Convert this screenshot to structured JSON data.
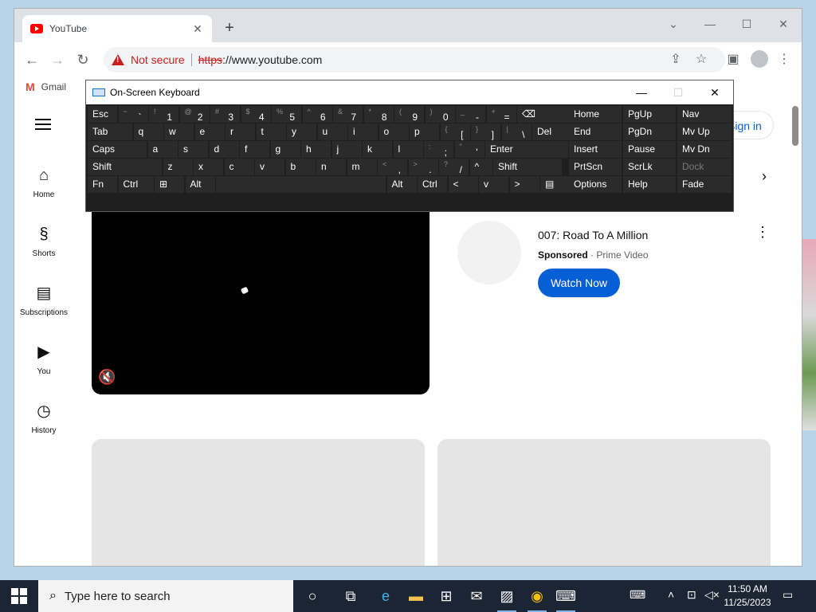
{
  "browser": {
    "tab_title": "YouTube",
    "tab_close": "✕",
    "new_tab": "+",
    "address": {
      "security_label": "Not secure",
      "scheme": "https",
      "rest": "://www.youtube.com"
    },
    "bookmarks": [
      {
        "label": "Gmail"
      }
    ]
  },
  "youtube": {
    "signin_label": "Sign in",
    "sidebar": [
      {
        "label": "Home",
        "icon": "home-icon"
      },
      {
        "label": "Shorts",
        "icon": "shorts-icon"
      },
      {
        "label": "Subscriptions",
        "icon": "subscriptions-icon"
      },
      {
        "label": "You",
        "icon": "you-icon"
      },
      {
        "label": "History",
        "icon": "history-icon"
      }
    ],
    "ad": {
      "title": "007: Road To A Million",
      "sponsored": "Sponsored",
      "separator": " · ",
      "advertiser": "Prime Video",
      "cta": "Watch Now"
    }
  },
  "osk": {
    "title": "On-Screen Keyboard",
    "rows": [
      [
        {
          "t": "Esc"
        },
        {
          "s": "~",
          "m": "`"
        },
        {
          "s": "!",
          "m": "1"
        },
        {
          "s": "@",
          "m": "2"
        },
        {
          "s": "#",
          "m": "3"
        },
        {
          "s": "$",
          "m": "4"
        },
        {
          "s": "%",
          "m": "5"
        },
        {
          "s": "^",
          "m": "6"
        },
        {
          "s": "&",
          "m": "7"
        },
        {
          "s": "*",
          "m": "8"
        },
        {
          "s": "(",
          "m": "9"
        },
        {
          "s": ")",
          "m": "0"
        },
        {
          "s": "_",
          "m": "-"
        },
        {
          "s": "+",
          "m": "="
        },
        {
          "t": "⌫"
        }
      ],
      [
        {
          "t": "Tab"
        },
        {
          "t": "q"
        },
        {
          "t": "w"
        },
        {
          "t": "e"
        },
        {
          "t": "r"
        },
        {
          "t": "t"
        },
        {
          "t": "y"
        },
        {
          "t": "u"
        },
        {
          "t": "i"
        },
        {
          "t": "o"
        },
        {
          "t": "p"
        },
        {
          "s": "{",
          "m": "["
        },
        {
          "s": "}",
          "m": "]"
        },
        {
          "s": "|",
          "m": "\\"
        },
        {
          "t": "Del"
        }
      ],
      [
        {
          "t": "Caps"
        },
        {
          "t": "a"
        },
        {
          "t": "s"
        },
        {
          "t": "d"
        },
        {
          "t": "f"
        },
        {
          "t": "g"
        },
        {
          "t": "h"
        },
        {
          "t": "j"
        },
        {
          "t": "k"
        },
        {
          "t": "l"
        },
        {
          "s": ":",
          "m": ";"
        },
        {
          "s": "\"",
          "m": "'"
        },
        {
          "t": "Enter"
        }
      ],
      [
        {
          "t": "Shift"
        },
        {
          "t": "z"
        },
        {
          "t": "x"
        },
        {
          "t": "c"
        },
        {
          "t": "v"
        },
        {
          "t": "b"
        },
        {
          "t": "n"
        },
        {
          "t": "m"
        },
        {
          "s": "<",
          "m": ","
        },
        {
          "s": ">",
          "m": "."
        },
        {
          "s": "?",
          "m": "/"
        },
        {
          "t": "^"
        },
        {
          "t": "Shift"
        }
      ],
      [
        {
          "t": "Fn"
        },
        {
          "t": "Ctrl"
        },
        {
          "t": "win-logo"
        },
        {
          "t": "Alt"
        },
        {
          "t": ""
        },
        {
          "t": "Alt"
        },
        {
          "t": "Ctrl"
        },
        {
          "t": "<"
        },
        {
          "t": "v"
        },
        {
          "t": ">"
        },
        {
          "t": "menu-icon"
        }
      ]
    ],
    "nav_keys": [
      [
        "Home",
        "PgUp",
        "Nav"
      ],
      [
        "End",
        "PgDn",
        "Mv Up"
      ],
      [
        "Insert",
        "Pause",
        "Mv Dn"
      ],
      [
        "PrtScn",
        "ScrLk",
        "Dock"
      ],
      [
        "Options",
        "Help",
        "Fade"
      ]
    ]
  },
  "taskbar": {
    "search_placeholder": "Type here to search",
    "time": "11:50 AM",
    "date": "11/25/2023"
  }
}
